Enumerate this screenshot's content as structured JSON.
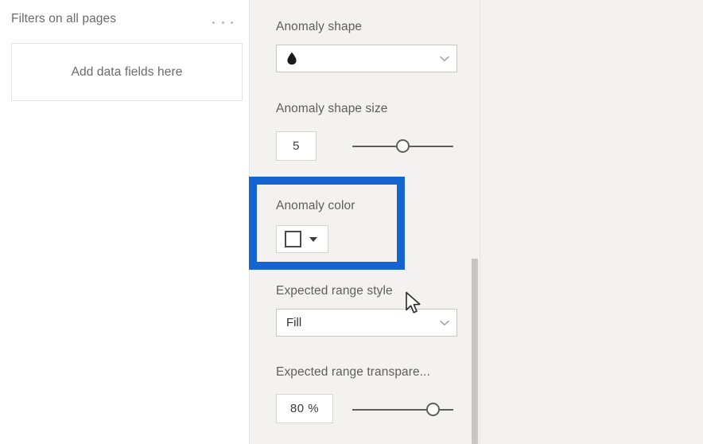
{
  "filters_pane": {
    "title": "Filters on all pages",
    "more_icon": "ellipsis-icon",
    "dropzone_label": "Add data fields here"
  },
  "format_pane": {
    "anomaly_shape": {
      "label": "Anomaly shape",
      "value": "",
      "shape_icon": "teardrop-shape-icon",
      "chevron_icon": "chevron-down-icon"
    },
    "anomaly_shape_size": {
      "label": "Anomaly shape size",
      "value": "5",
      "slider_percent": 50
    },
    "anomaly_color": {
      "label": "Anomaly color",
      "swatch_color": "#ffffff",
      "caret_icon": "caret-down-icon"
    },
    "expected_range_style": {
      "label": "Expected range style",
      "value": "Fill",
      "chevron_icon": "chevron-down-icon"
    },
    "expected_range_transparency": {
      "label": "Expected range transpare...",
      "value": "80  %",
      "slider_percent": 80
    },
    "scrollbar": {
      "thumb_color": "#c8c6c4"
    }
  },
  "annotation": {
    "highlight_color": "#1464d2",
    "target": "anomaly-color"
  },
  "cursor": {
    "icon": "arrow-pointer-icon"
  }
}
